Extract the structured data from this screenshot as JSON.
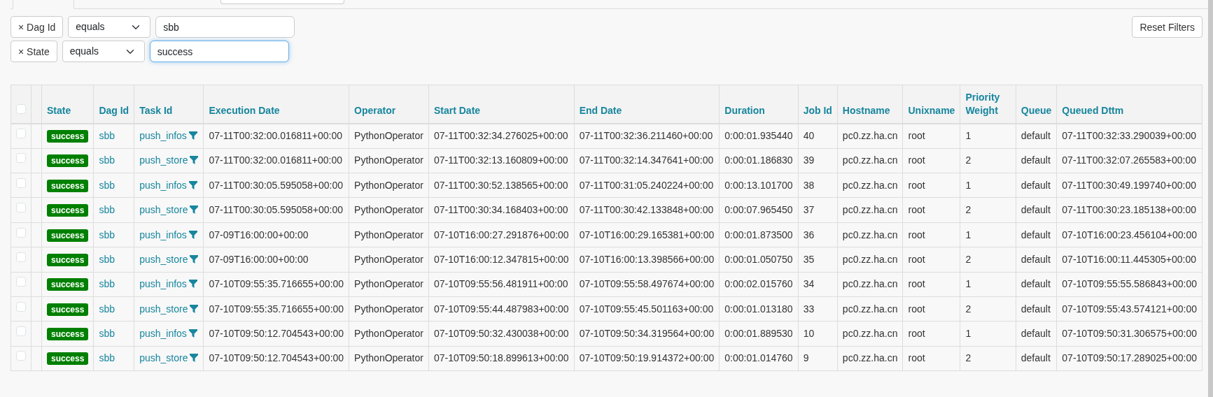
{
  "filters": [
    {
      "label": "× Dag Id",
      "operator": "equals",
      "value": "sbb",
      "focused": false
    },
    {
      "label": "× State",
      "operator": "equals",
      "value": "success",
      "focused": true
    }
  ],
  "reset_button": "Reset Filters",
  "table": {
    "select_all": {
      "checked": false
    },
    "columns": [
      "State",
      "Dag Id",
      "Task Id",
      "Execution Date",
      "Operator",
      "Start Date",
      "End Date",
      "Duration",
      "Job Id",
      "Hostname",
      "Unixname",
      "Priority Weight",
      "Queue",
      "Queued Dttm"
    ],
    "rows": [
      {
        "checked": false,
        "state": "success",
        "dag_id": "sbb",
        "task_id": "push_infos",
        "execution_date": "07-11T00:32:00.016811+00:00",
        "operator": "PythonOperator",
        "start_date": "07-11T00:32:34.276025+00:00",
        "end_date": "07-11T00:32:36.211460+00:00",
        "duration": "0:00:01.935440",
        "job_id": "40",
        "hostname": "pc0.zz.ha.cn",
        "unixname": "root",
        "priority_weight": "1",
        "queue": "default",
        "queued_dttm": "07-11T00:32:33.290039+00:00"
      },
      {
        "checked": false,
        "state": "success",
        "dag_id": "sbb",
        "task_id": "push_store",
        "execution_date": "07-11T00:32:00.016811+00:00",
        "operator": "PythonOperator",
        "start_date": "07-11T00:32:13.160809+00:00",
        "end_date": "07-11T00:32:14.347641+00:00",
        "duration": "0:00:01.186830",
        "job_id": "39",
        "hostname": "pc0.zz.ha.cn",
        "unixname": "root",
        "priority_weight": "2",
        "queue": "default",
        "queued_dttm": "07-11T00:32:07.265583+00:00"
      },
      {
        "checked": false,
        "state": "success",
        "dag_id": "sbb",
        "task_id": "push_infos",
        "execution_date": "07-11T00:30:05.595058+00:00",
        "operator": "PythonOperator",
        "start_date": "07-11T00:30:52.138565+00:00",
        "end_date": "07-11T00:31:05.240224+00:00",
        "duration": "0:00:13.101700",
        "job_id": "38",
        "hostname": "pc0.zz.ha.cn",
        "unixname": "root",
        "priority_weight": "1",
        "queue": "default",
        "queued_dttm": "07-11T00:30:49.199740+00:00"
      },
      {
        "checked": false,
        "state": "success",
        "dag_id": "sbb",
        "task_id": "push_store",
        "execution_date": "07-11T00:30:05.595058+00:00",
        "operator": "PythonOperator",
        "start_date": "07-11T00:30:34.168403+00:00",
        "end_date": "07-11T00:30:42.133848+00:00",
        "duration": "0:00:07.965450",
        "job_id": "37",
        "hostname": "pc0.zz.ha.cn",
        "unixname": "root",
        "priority_weight": "2",
        "queue": "default",
        "queued_dttm": "07-11T00:30:23.185138+00:00"
      },
      {
        "checked": false,
        "state": "success",
        "dag_id": "sbb",
        "task_id": "push_infos",
        "execution_date": "07-09T16:00:00+00:00",
        "operator": "PythonOperator",
        "start_date": "07-10T16:00:27.291876+00:00",
        "end_date": "07-10T16:00:29.165381+00:00",
        "duration": "0:00:01.873500",
        "job_id": "36",
        "hostname": "pc0.zz.ha.cn",
        "unixname": "root",
        "priority_weight": "1",
        "queue": "default",
        "queued_dttm": "07-10T16:00:23.456104+00:00"
      },
      {
        "checked": false,
        "state": "success",
        "dag_id": "sbb",
        "task_id": "push_store",
        "execution_date": "07-09T16:00:00+00:00",
        "operator": "PythonOperator",
        "start_date": "07-10T16:00:12.347815+00:00",
        "end_date": "07-10T16:00:13.398566+00:00",
        "duration": "0:00:01.050750",
        "job_id": "35",
        "hostname": "pc0.zz.ha.cn",
        "unixname": "root",
        "priority_weight": "2",
        "queue": "default",
        "queued_dttm": "07-10T16:00:11.445305+00:00"
      },
      {
        "checked": false,
        "state": "success",
        "dag_id": "sbb",
        "task_id": "push_infos",
        "execution_date": "07-10T09:55:35.716655+00:00",
        "operator": "PythonOperator",
        "start_date": "07-10T09:55:56.481911+00:00",
        "end_date": "07-10T09:55:58.497674+00:00",
        "duration": "0:00:02.015760",
        "job_id": "34",
        "hostname": "pc0.zz.ha.cn",
        "unixname": "root",
        "priority_weight": "1",
        "queue": "default",
        "queued_dttm": "07-10T09:55:55.586843+00:00"
      },
      {
        "checked": false,
        "state": "success",
        "dag_id": "sbb",
        "task_id": "push_store",
        "execution_date": "07-10T09:55:35.716655+00:00",
        "operator": "PythonOperator",
        "start_date": "07-10T09:55:44.487983+00:00",
        "end_date": "07-10T09:55:45.501163+00:00",
        "duration": "0:00:01.013180",
        "job_id": "33",
        "hostname": "pc0.zz.ha.cn",
        "unixname": "root",
        "priority_weight": "2",
        "queue": "default",
        "queued_dttm": "07-10T09:55:43.574121+00:00"
      },
      {
        "checked": false,
        "state": "success",
        "dag_id": "sbb",
        "task_id": "push_infos",
        "execution_date": "07-10T09:50:12.704543+00:00",
        "operator": "PythonOperator",
        "start_date": "07-10T09:50:32.430038+00:00",
        "end_date": "07-10T09:50:34.319564+00:00",
        "duration": "0:00:01.889530",
        "job_id": "10",
        "hostname": "pc0.zz.ha.cn",
        "unixname": "root",
        "priority_weight": "1",
        "queue": "default",
        "queued_dttm": "07-10T09:50:31.306575+00:00"
      },
      {
        "checked": false,
        "state": "success",
        "dag_id": "sbb",
        "task_id": "push_store",
        "execution_date": "07-10T09:50:12.704543+00:00",
        "operator": "PythonOperator",
        "start_date": "07-10T09:50:18.899613+00:00",
        "end_date": "07-10T09:50:19.914372+00:00",
        "duration": "0:00:01.014760",
        "job_id": "9",
        "hostname": "pc0.zz.ha.cn",
        "unixname": "root",
        "priority_weight": "2",
        "queue": "default",
        "queued_dttm": "07-10T09:50:17.289025+00:00"
      }
    ]
  }
}
